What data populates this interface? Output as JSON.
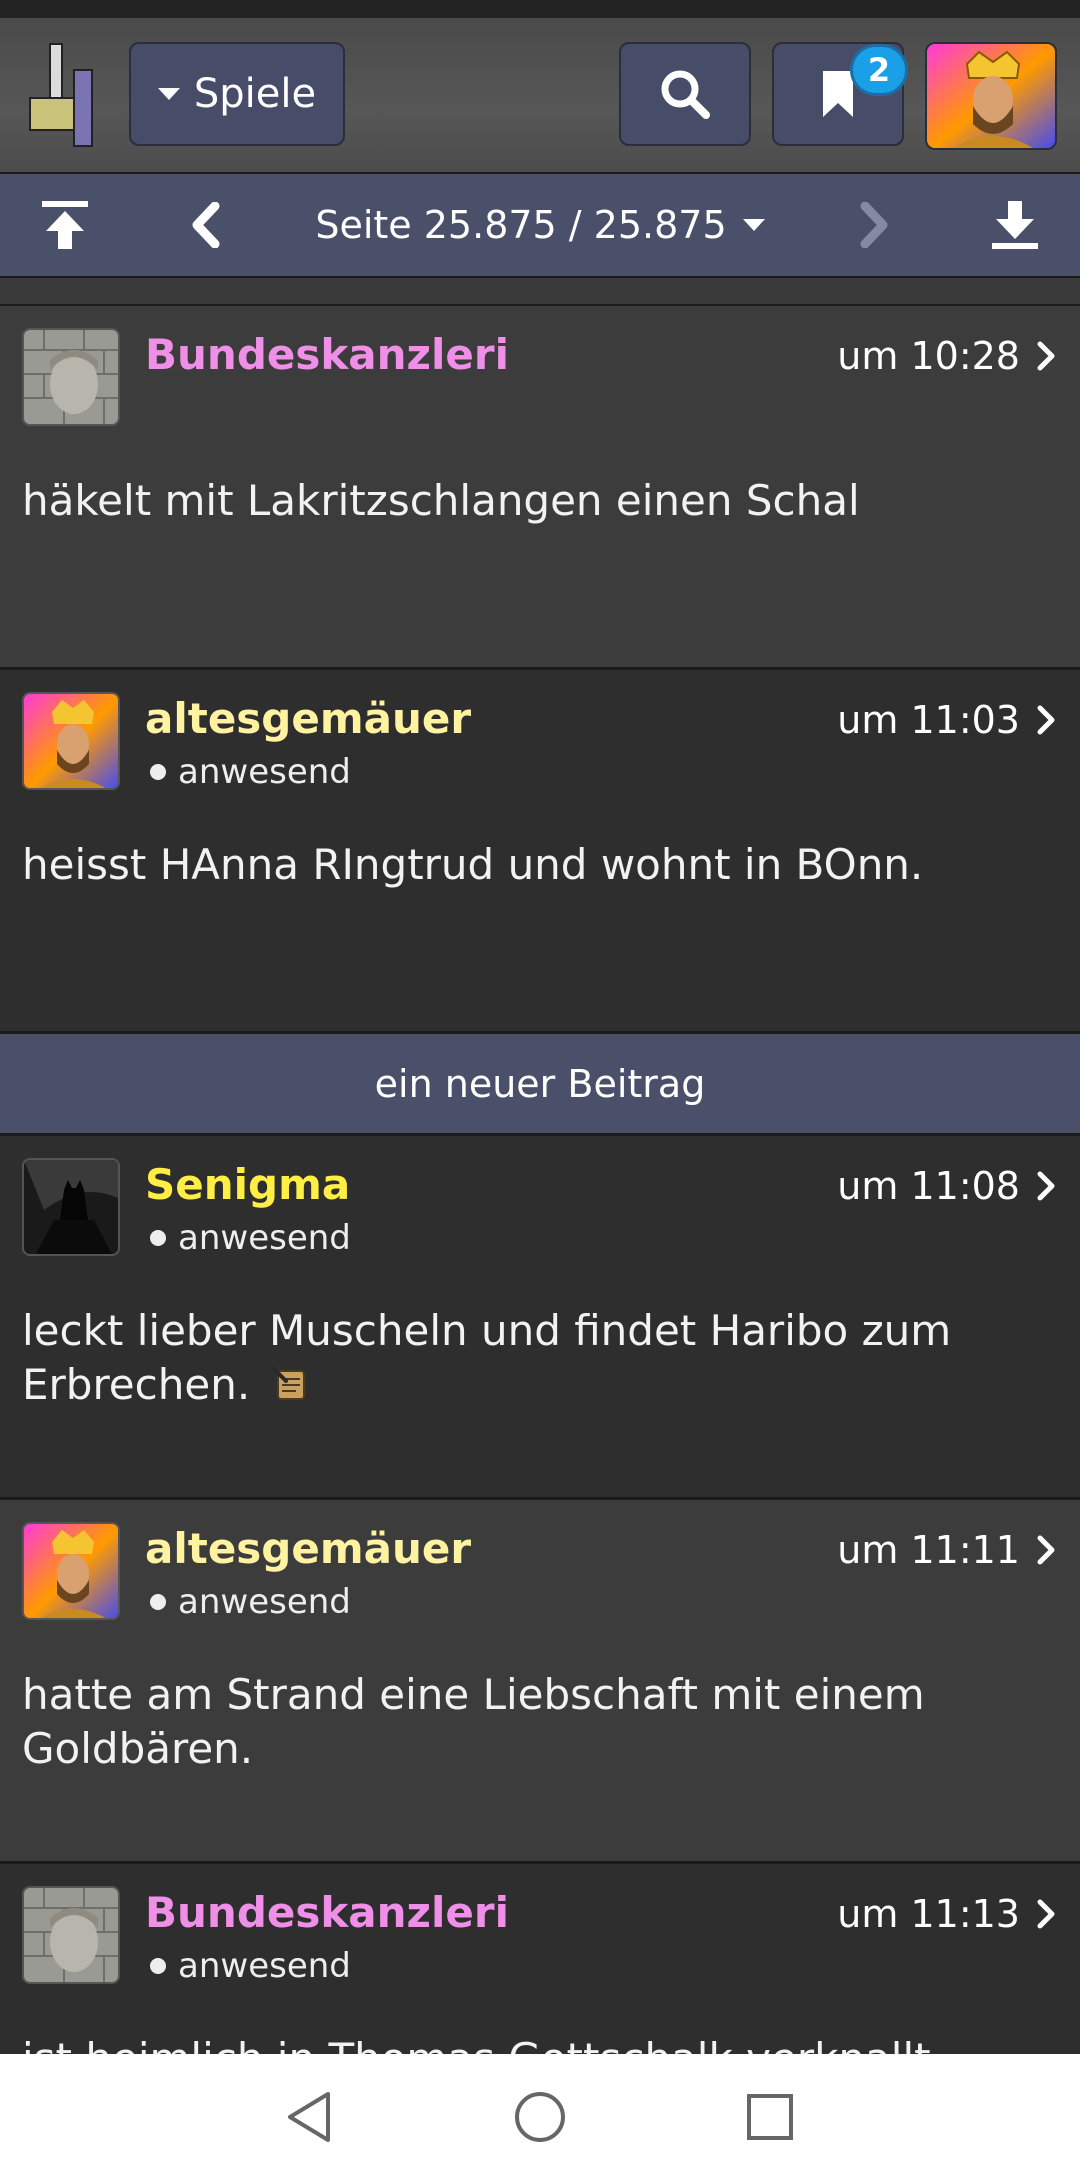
{
  "header": {
    "games_label": "Spiele",
    "bookmark_count": "2"
  },
  "pagination": {
    "page_label": "Seite 25.875 / 25.875"
  },
  "new_post_divider": "ein neuer Beitrag",
  "posts": [
    {
      "user": "Bundeskanzleri",
      "user_color": "#f08fe8",
      "time": "um 10:28",
      "status": "",
      "text": "häkelt mit Lakritzschlangen einen Schal"
    },
    {
      "user": "altesgemäuer",
      "user_color": "#fff2a0",
      "time": "um 11:03",
      "status": "anwesend",
      "text": "heisst HAnna RIngtrud und wohnt in BOnn."
    },
    {
      "user": "Senigma",
      "user_color": "#ffee44",
      "time": "um 11:08",
      "status": "anwesend",
      "text": "leckt lieber Muscheln und findet Haribo zum Erbrechen."
    },
    {
      "user": "altesgemäuer",
      "user_color": "#fff2a0",
      "time": "um 11:11",
      "status": "anwesend",
      "text": "hatte am Strand eine Liebschaft mit einem Goldbären."
    },
    {
      "user": "Bundeskanzleri",
      "user_color": "#f08fe8",
      "time": "um 11:13",
      "status": "anwesend",
      "text": "ist heimlich in Thomas Gottschalk verknallt"
    }
  ]
}
